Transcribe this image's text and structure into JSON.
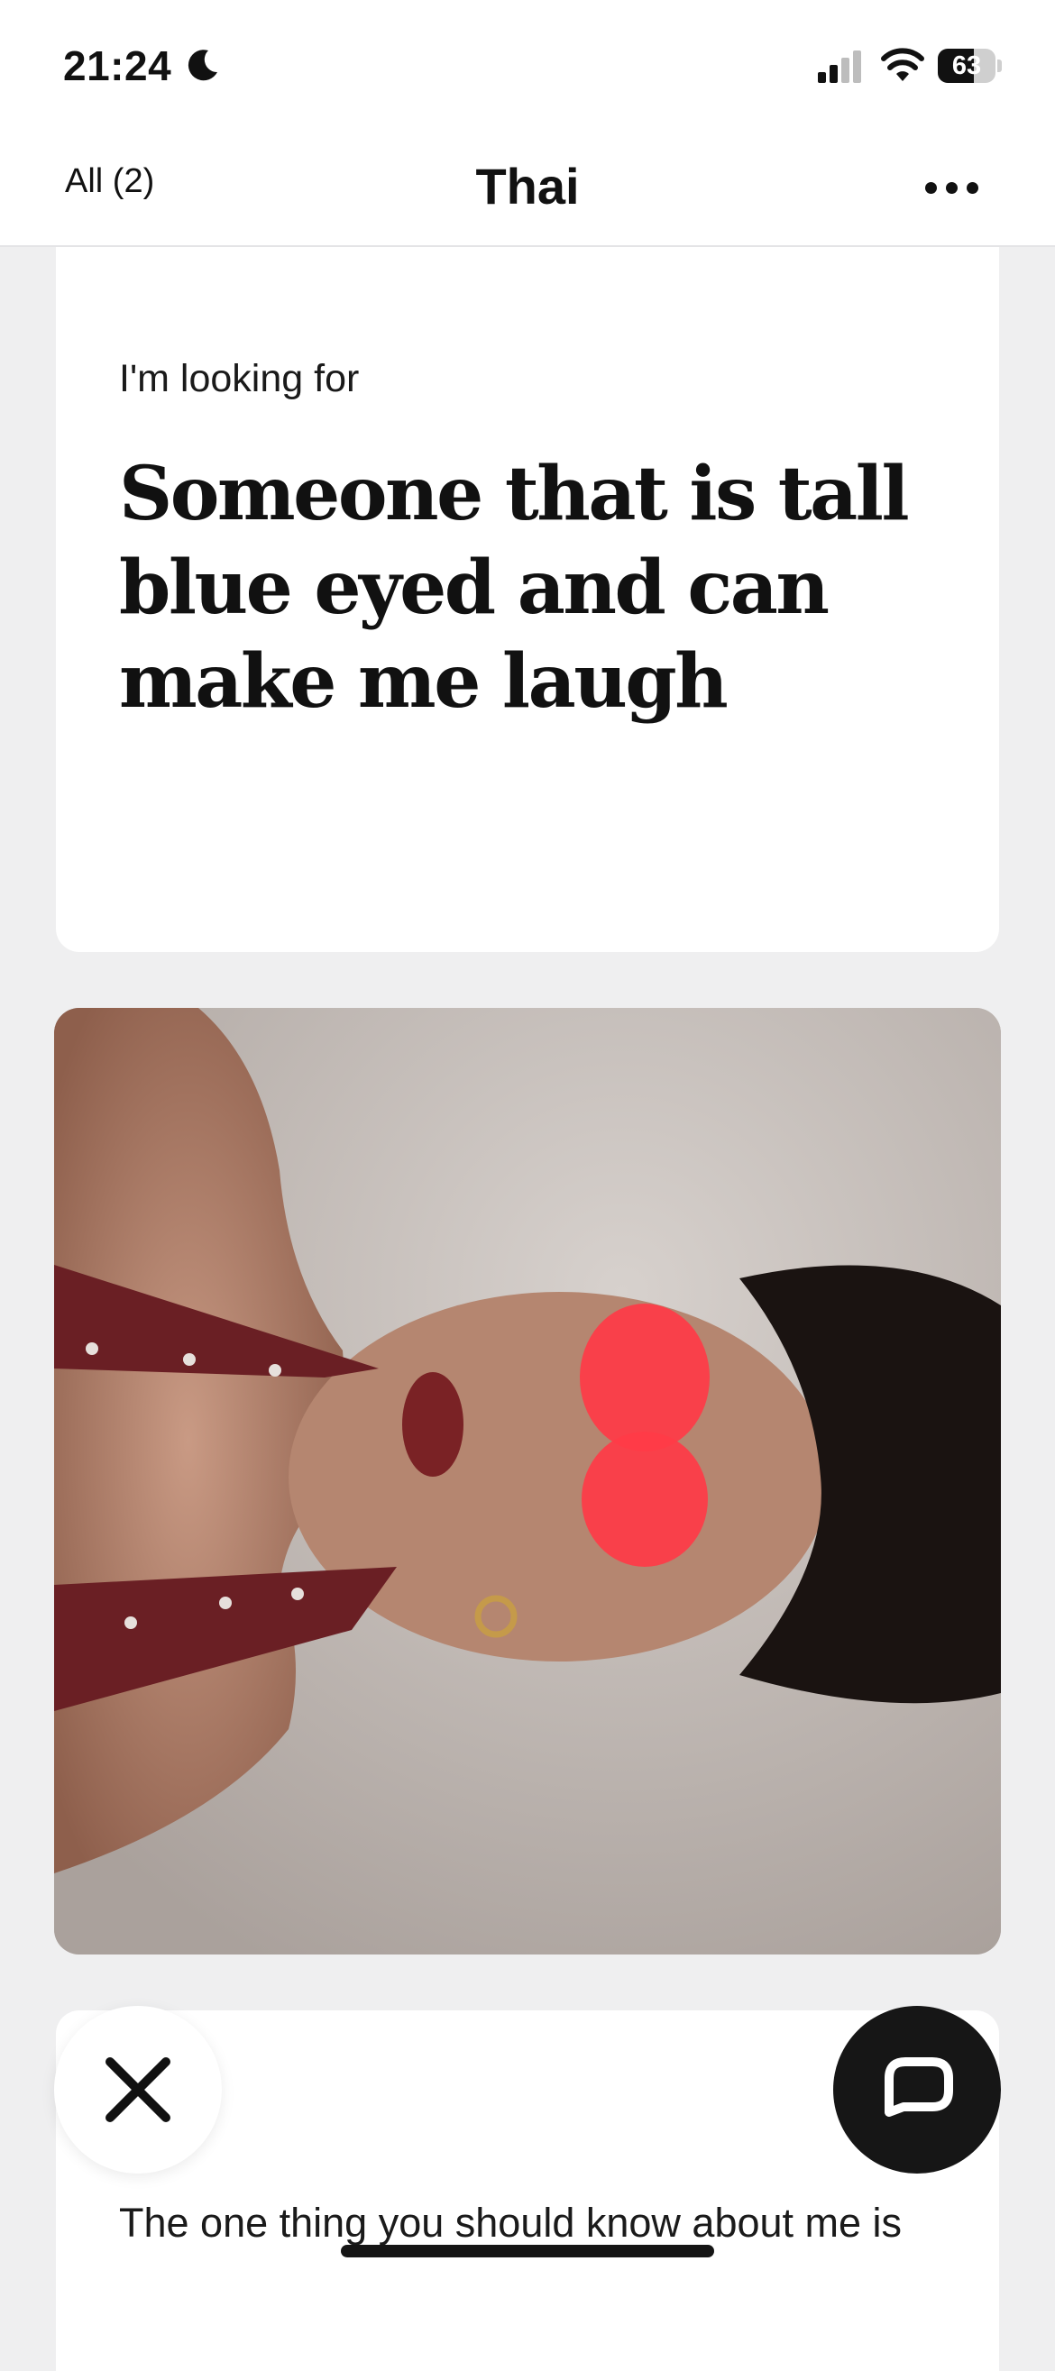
{
  "status_bar": {
    "time": "21:24",
    "battery_level": "63",
    "icons": [
      "moon-icon",
      "cellular-signal-icon",
      "wifi-icon",
      "battery-icon"
    ]
  },
  "nav": {
    "back_label": "All (2)",
    "title": "Thai",
    "more_icon": "more-horizontal-icon"
  },
  "profile": {
    "prompts": [
      {
        "question": "I'm looking for",
        "answer": "Someone that is tall blue eyed and can make me laugh"
      },
      {
        "question": "The one thing you should know about me is"
      }
    ],
    "photo": {
      "icon": "profile-photo",
      "accent_overlay": "#ff3b47"
    }
  },
  "actions": {
    "skip_icon": "close-x-icon",
    "chat_icon": "chat-bubble-icon"
  },
  "colors": {
    "background": "#efeff0",
    "card": "#ffffff",
    "text": "#111111",
    "chat_button": "#161616"
  }
}
